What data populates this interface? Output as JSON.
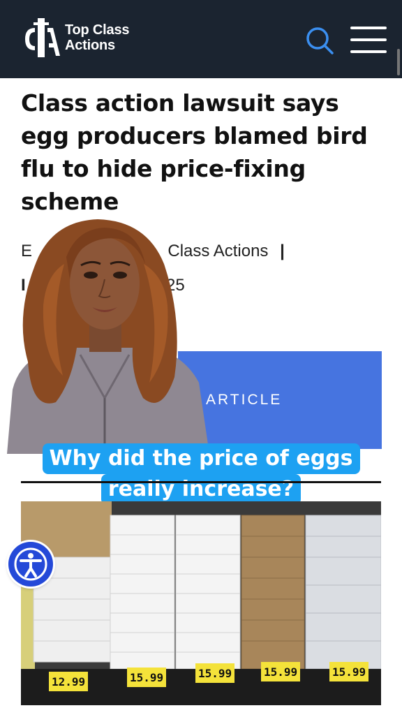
{
  "header": {
    "logo_line1": "Top Class",
    "logo_line2": "Actions",
    "logo_mark": "CTA",
    "search_icon": "search-icon",
    "menu_icon": "hamburger-menu-icon"
  },
  "article": {
    "headline": "Class action lawsuit says egg producers blamed bird flu to hide price-fixing scheme",
    "byline_visible": "Class Actions",
    "byline_separator": "|",
    "date_visible": "25",
    "byline_initial": "E",
    "date_initial": "I"
  },
  "banner": {
    "label": "ARTICLE",
    "color": "#4674e0"
  },
  "caption": {
    "line1": "Why did the price of eggs",
    "line2": "really increase?",
    "color": "#1da1f2"
  },
  "photo": {
    "price_tags": [
      "12.99",
      "15.99",
      "15.99",
      "15.99",
      "15.99"
    ]
  },
  "colors": {
    "header_bg": "#1b2430",
    "accessibility_button": "#2449d8"
  }
}
